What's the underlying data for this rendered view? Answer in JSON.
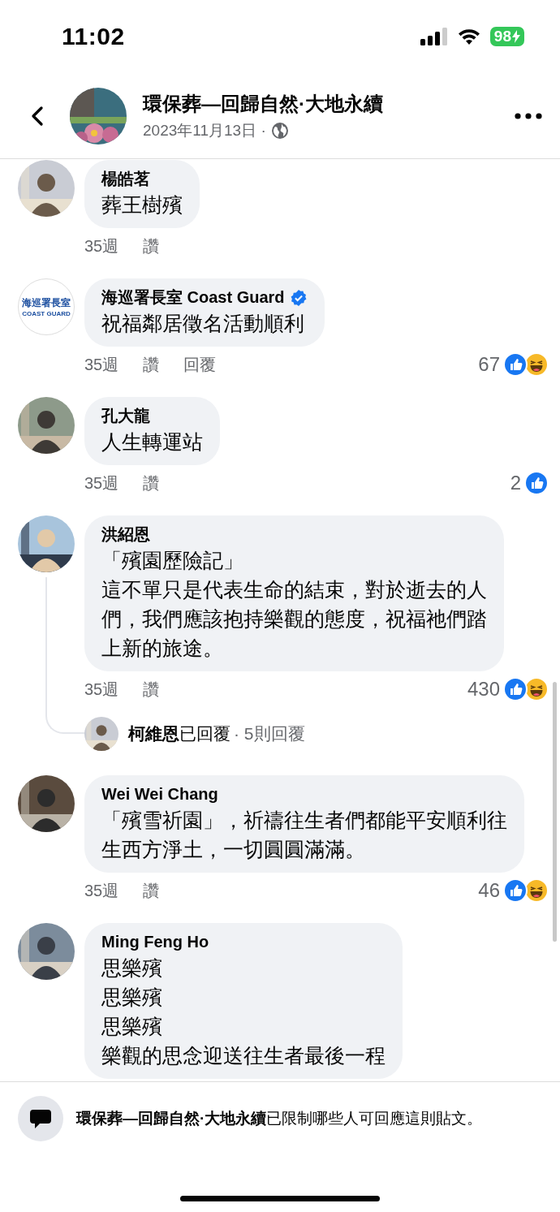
{
  "status_bar": {
    "time": "11:02",
    "battery": "98"
  },
  "header": {
    "title": "環保葬—回歸自然·大地永續",
    "date": "2023年11月13日 ·"
  },
  "comments": [
    {
      "author": "楊皓茗",
      "verified": false,
      "lines": [
        "葬王樹殯"
      ],
      "time": "35週",
      "like": "讚"
    },
    {
      "author": "海巡署長室 Coast Guard",
      "verified": true,
      "avatar_text": [
        "海巡署長室",
        "COAST GUARD"
      ],
      "lines": [
        "祝福鄰居徵名活動順利"
      ],
      "time": "35週",
      "like": "讚",
      "reply": "回覆",
      "reaction_count": "67",
      "reactions": [
        {
          "kind": "like"
        },
        {
          "kind": "haha"
        }
      ]
    },
    {
      "author": "孔大龍",
      "verified": false,
      "lines": [
        "人生轉運站"
      ],
      "time": "35週",
      "like": "讚",
      "reaction_count": "2",
      "reactions": [
        {
          "kind": "like"
        }
      ]
    },
    {
      "author": "洪紹恩",
      "verified": false,
      "lines": [
        "「殯園歷險記」",
        "這不單只是代表生命的結束，對於逝去的人",
        "們，我們應該抱持樂觀的態度，祝福祂們踏",
        "上新的旅途。"
      ],
      "time": "35週",
      "like": "讚",
      "reaction_count": "430",
      "reactions": [
        {
          "kind": "like"
        },
        {
          "kind": "haha"
        }
      ],
      "replies": {
        "author": "柯維恩",
        "text": "已回覆",
        "count": "· 5則回覆"
      }
    },
    {
      "author": "Wei Wei Chang",
      "verified": false,
      "lines": [
        "「殯雪祈園」，祈禱往生者們都能平安順利往",
        "生西方淨土，一切圓圓滿滿。"
      ],
      "time": "35週",
      "like": "讚",
      "reaction_count": "46",
      "reactions": [
        {
          "kind": "like"
        },
        {
          "kind": "haha"
        }
      ]
    },
    {
      "author": "Ming Feng Ho",
      "verified": false,
      "lines": [
        "思樂殯",
        "思樂殯",
        "思樂殯",
        "樂觀的思念迎送往生者最後一程"
      ]
    }
  ],
  "footer": {
    "page_name": "環保葬—回歸自然·大地永續",
    "notice": "已限制哪些人可回應這則貼文。"
  }
}
